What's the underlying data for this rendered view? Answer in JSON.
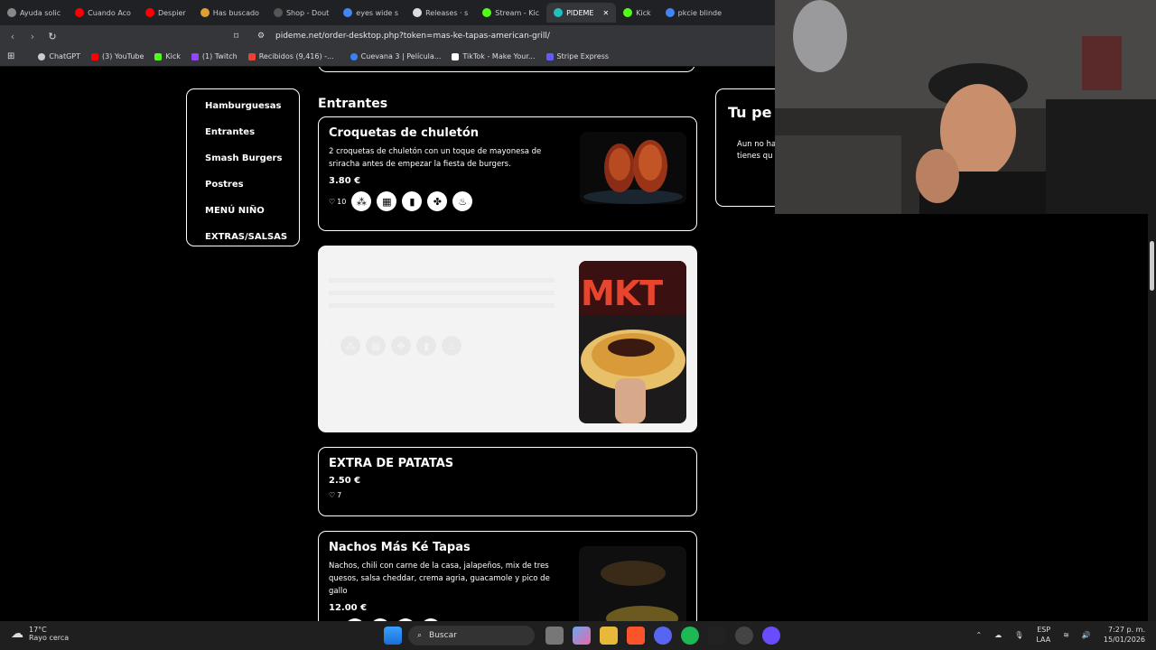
{
  "browser": {
    "tabs": [
      {
        "label": "Ayuda solic",
        "color": "#888888"
      },
      {
        "label": "Cuando Aco",
        "color": "#ff0000"
      },
      {
        "label": "Despier",
        "color": "#ff0000"
      },
      {
        "label": "Has buscado",
        "color": "#e0a030"
      },
      {
        "label": "Shop - Dout",
        "color": "#555555"
      },
      {
        "label": "eyes wide s",
        "color": "#4285f4"
      },
      {
        "label": "Releases · s",
        "color": "#dddddd"
      },
      {
        "label": "Stream - Kic",
        "color": "#53fc18"
      },
      {
        "label": "PIDEME",
        "color": "#20c0c0"
      },
      {
        "label": "Kick",
        "color": "#53fc18"
      },
      {
        "label": "pkcie blinde",
        "color": "#4285f4"
      }
    ],
    "url": "pideme.net/order-desktop.php?token=mas-ke-tapas-american-grill/",
    "bookmarks": [
      {
        "label": "ChatGPT",
        "color": "#cccccc"
      },
      {
        "label": "(3) YouTube",
        "color": "#ff0000"
      },
      {
        "label": "Kick",
        "color": "#53fc18"
      },
      {
        "label": "(1) Twitch",
        "color": "#9146ff"
      },
      {
        "label": "Recibidos (9,416) -...",
        "color": "#ea4335"
      },
      {
        "label": "Cuevana 3 | Película...",
        "color": "#3b82f6"
      },
      {
        "label": "TikTok - Make Your...",
        "color": "#ffffff"
      },
      {
        "label": "Stripe Express",
        "color": "#635bff"
      }
    ]
  },
  "sidebar": {
    "categories": [
      "Hamburguesas",
      "Entrantes",
      "Smash Burgers",
      "Postres",
      "MENÚ NIÑO",
      "EXTRAS/SALSAS"
    ]
  },
  "section_title": "Entrantes",
  "products": [
    {
      "name": "Croquetas de chuletón",
      "desc": "2 croquetas de chuletón con un toque de mayonesa de sriracha antes de empezar la fiesta de burgers.",
      "price": "3.80 €",
      "likes": "10"
    },
    {
      "name": "MKT",
      "price": "",
      "likes": ""
    },
    {
      "name": "EXTRA DE PATATAS",
      "price": "2.50 €",
      "likes": "7"
    },
    {
      "name": "Nachos Más Ké Tapas",
      "desc": "Nachos, chili con carne de la casa, jalapeños, mix de tres quesos, salsa cheddar, crema agria, guacamole y pico de gallo",
      "price": "12.00 €"
    }
  ],
  "order": {
    "title": "Tu pe",
    "msg_line1": "Aun no ha",
    "msg_line2": "tienes qu"
  },
  "taskbar": {
    "temp": "17°C",
    "weather": "Rayo cerca",
    "search_placeholder": "Buscar",
    "lang": "ESP",
    "lang2": "LAA",
    "time": "7:27 p. m.",
    "date": "15/01/2026"
  }
}
